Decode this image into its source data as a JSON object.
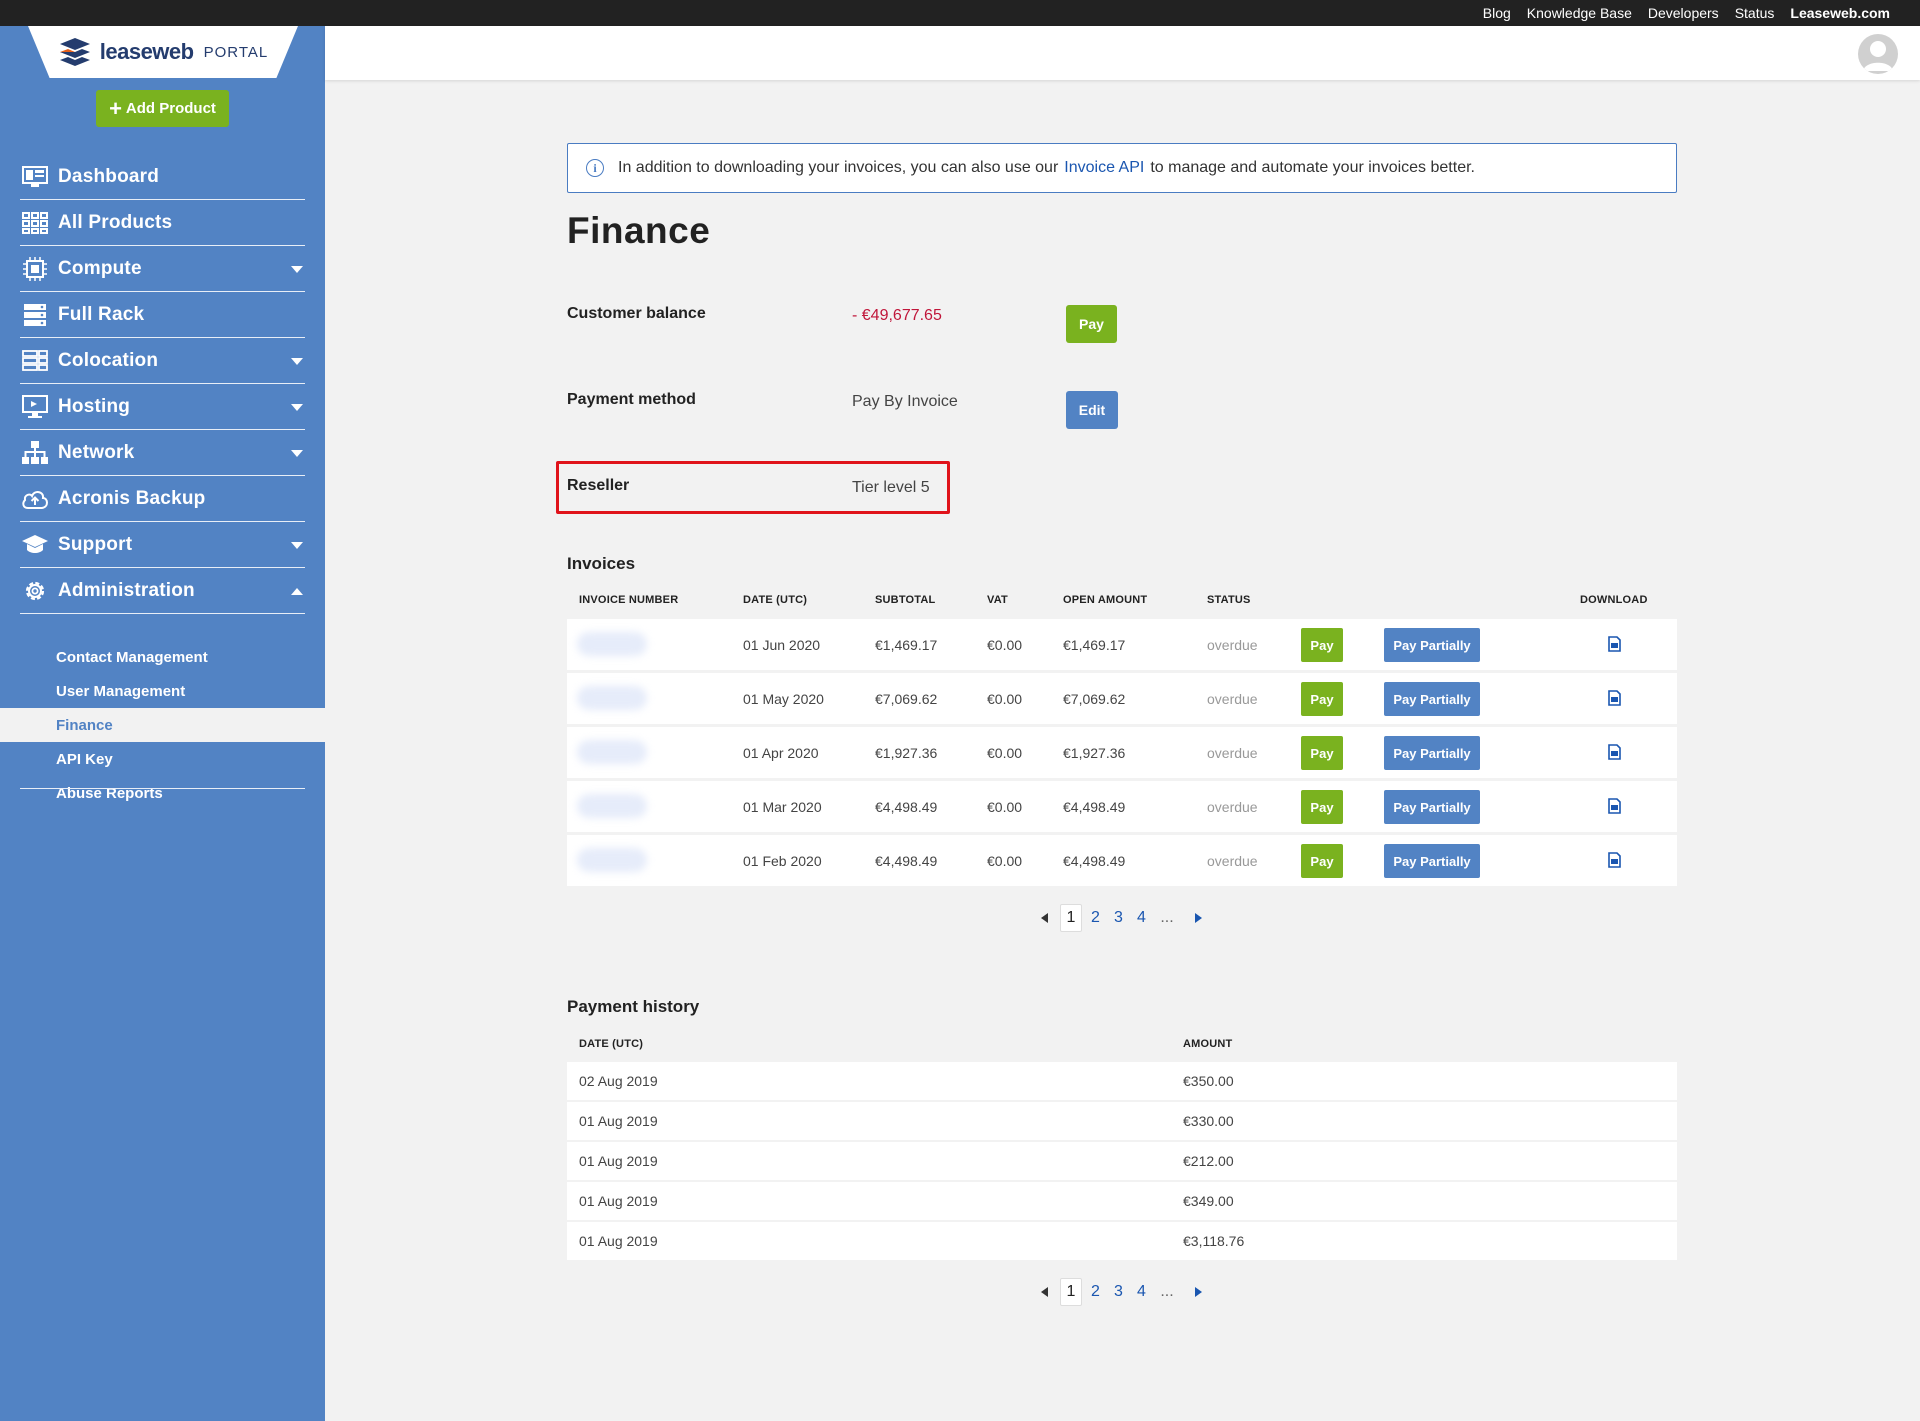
{
  "topbar": {
    "links": [
      "Blog",
      "Knowledge Base",
      "Developers",
      "Status",
      "Leaseweb.com"
    ]
  },
  "brand": {
    "name": "leaseweb",
    "suffix": "PORTAL"
  },
  "sidebar": {
    "add_product": "Add Product",
    "items": [
      {
        "label": "Dashboard",
        "icon": "dashboard-icon"
      },
      {
        "label": "All Products",
        "icon": "grid-icon"
      },
      {
        "label": "Compute",
        "icon": "chip-icon"
      },
      {
        "label": "Full Rack",
        "icon": "rack-icon"
      },
      {
        "label": "Colocation",
        "icon": "colocation-icon"
      },
      {
        "label": "Hosting",
        "icon": "monitor-icon"
      },
      {
        "label": "Network",
        "icon": "network-icon"
      },
      {
        "label": "Acronis Backup",
        "icon": "cloud-upload-icon"
      },
      {
        "label": "Support",
        "icon": "graduation-cap-icon"
      },
      {
        "label": "Administration",
        "icon": "gear-icon"
      }
    ],
    "subitems": [
      "Contact Management",
      "User Management",
      "Finance",
      "API Key",
      "Abuse Reports"
    ],
    "active_subitem": "Finance"
  },
  "info_banner": {
    "before": "In addition to downloading your invoices, you can also use our",
    "link": "Invoice API",
    "after": "to manage and automate your invoices better."
  },
  "page": {
    "title": "Finance"
  },
  "summary": {
    "customer_balance_label": "Customer balance",
    "customer_balance_value": "- €49,677.65",
    "pay_label": "Pay",
    "payment_method_label": "Payment method",
    "payment_method_value": "Pay By Invoice",
    "edit_label": "Edit",
    "reseller_label": "Reseller",
    "reseller_value": "Tier level 5"
  },
  "invoices": {
    "title": "Invoices",
    "headers": [
      "INVOICE NUMBER",
      "DATE (UTC)",
      "SUBTOTAL",
      "VAT",
      "OPEN AMOUNT",
      "STATUS",
      "DOWNLOAD"
    ],
    "pay_label": "Pay",
    "pay_partially_label": "Pay Partially",
    "rows": [
      {
        "date": "01 Jun 2020",
        "subtotal": "€1,469.17",
        "vat": "€0.00",
        "open": "€1,469.17",
        "status": "overdue"
      },
      {
        "date": "01 May 2020",
        "subtotal": "€7,069.62",
        "vat": "€0.00",
        "open": "€7,069.62",
        "status": "overdue"
      },
      {
        "date": "01 Apr 2020",
        "subtotal": "€1,927.36",
        "vat": "€0.00",
        "open": "€1,927.36",
        "status": "overdue"
      },
      {
        "date": "01 Mar 2020",
        "subtotal": "€4,498.49",
        "vat": "€0.00",
        "open": "€4,498.49",
        "status": "overdue"
      },
      {
        "date": "01 Feb 2020",
        "subtotal": "€4,498.49",
        "vat": "€0.00",
        "open": "€4,498.49",
        "status": "overdue"
      }
    ],
    "pagination": {
      "pages": [
        "1",
        "2",
        "3",
        "4"
      ],
      "current": "1",
      "ellipsis": "..."
    }
  },
  "payment_history": {
    "title": "Payment history",
    "headers": [
      "DATE (UTC)",
      "AMOUNT"
    ],
    "rows": [
      {
        "date": "02 Aug 2019",
        "amount": "€350.00"
      },
      {
        "date": "01 Aug 2019",
        "amount": "€330.00"
      },
      {
        "date": "01 Aug 2019",
        "amount": "€212.00"
      },
      {
        "date": "01 Aug 2019",
        "amount": "€349.00"
      },
      {
        "date": "01 Aug 2019",
        "amount": "€3,118.76"
      }
    ],
    "pagination": {
      "pages": [
        "1",
        "2",
        "3",
        "4"
      ],
      "current": "1",
      "ellipsis": "..."
    }
  },
  "colors": {
    "sidebar": "#5283c4",
    "green": "#7ab21f",
    "blue": "#5283c4",
    "negative": "#c0163a",
    "highlight": "#e0131b"
  }
}
